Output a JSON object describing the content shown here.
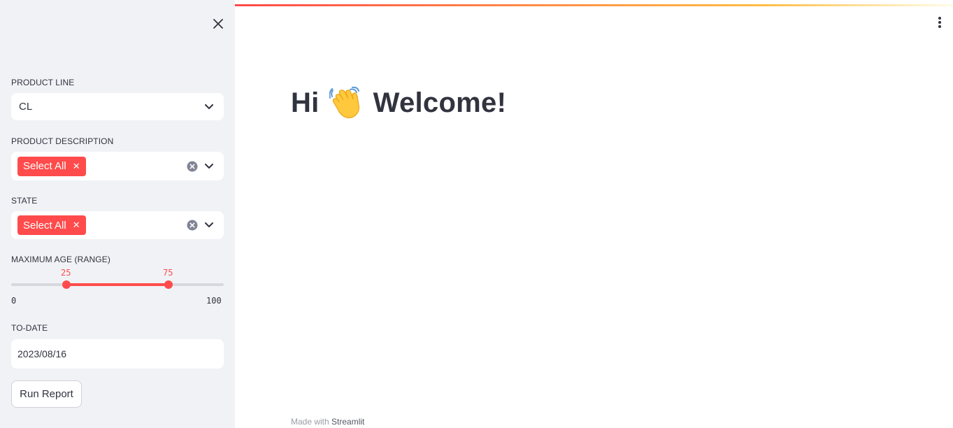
{
  "sidebar": {
    "product_line": {
      "label": "PRODUCT LINE",
      "value": "CL"
    },
    "product_description": {
      "label": "PRODUCT DESCRIPTION",
      "tag": "Select All"
    },
    "state": {
      "label": "STATE",
      "tag": "Select All"
    },
    "age_range": {
      "label": "MAXIMUM AGE (RANGE)",
      "low": "25",
      "high": "75",
      "min": "0",
      "max": "100"
    },
    "to_date": {
      "label": "TO-DATE",
      "value": "2023/08/16"
    },
    "run_button": "Run Report"
  },
  "main": {
    "greeting_before": "Hi",
    "greeting_after": "Welcome!",
    "footer_prefix": "Made with",
    "footer_brand": "Streamlit"
  },
  "colors": {
    "accent": "#ff4b4b",
    "sidebar_bg": "#f0f2f6",
    "text": "#31333f"
  },
  "icons": [
    "close-icon",
    "chevron-down-icon",
    "clear-icon",
    "waving-hand-icon",
    "more-vert-icon"
  ]
}
